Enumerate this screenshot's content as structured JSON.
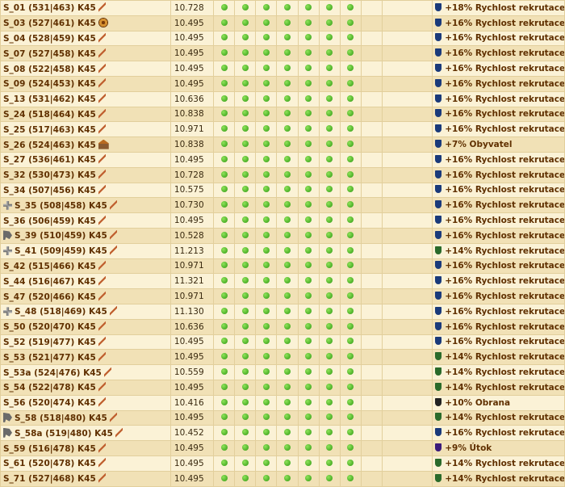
{
  "colors": {
    "green_dot": "#39a51a",
    "shield_blue": "#1a3a7a",
    "shield_green": "#2a6a2a",
    "shield_black": "#222222",
    "shield_purple": "#3a1a7a"
  },
  "rows": [
    {
      "name": "S_01 (531|463) K45",
      "points": "10.728",
      "bonus": "+18% Rychlost rekrutace",
      "pre": "",
      "post": "sword",
      "shield": "blue"
    },
    {
      "name": "S_03 (527|461) K45",
      "points": "10.495",
      "bonus": "+16% Rychlost rekrutace",
      "pre": "",
      "post": "wheel",
      "shield": "blue"
    },
    {
      "name": "S_04 (528|459) K45",
      "points": "10.495",
      "bonus": "+16% Rychlost rekrutace",
      "pre": "",
      "post": "sword",
      "shield": "blue"
    },
    {
      "name": "S_07 (527|458) K45",
      "points": "10.495",
      "bonus": "+16% Rychlost rekrutace",
      "pre": "",
      "post": "sword",
      "shield": "blue"
    },
    {
      "name": "S_08 (522|458) K45",
      "points": "10.495",
      "bonus": "+16% Rychlost rekrutace",
      "pre": "",
      "post": "sword",
      "shield": "blue"
    },
    {
      "name": "S_09 (524|453) K45",
      "points": "10.495",
      "bonus": "+16% Rychlost rekrutace",
      "pre": "",
      "post": "sword",
      "shield": "blue"
    },
    {
      "name": "S_13 (531|462) K45",
      "points": "10.636",
      "bonus": "+16% Rychlost rekrutace",
      "pre": "",
      "post": "sword",
      "shield": "blue"
    },
    {
      "name": "S_24 (518|464) K45",
      "points": "10.838",
      "bonus": "+16% Rychlost rekrutace",
      "pre": "",
      "post": "sword",
      "shield": "blue"
    },
    {
      "name": "S_25 (517|463) K45",
      "points": "10.971",
      "bonus": "+16% Rychlost rekrutace",
      "pre": "",
      "post": "sword",
      "shield": "blue"
    },
    {
      "name": "S_26 (524|463) K45",
      "points": "10.838",
      "bonus": "+7% Obyvatel",
      "pre": "",
      "post": "house",
      "shield": "blue"
    },
    {
      "name": "S_27 (536|461) K45",
      "points": "10.495",
      "bonus": "+16% Rychlost rekrutace",
      "pre": "",
      "post": "sword",
      "shield": "blue"
    },
    {
      "name": "S_32 (530|473) K45",
      "points": "10.728",
      "bonus": "+16% Rychlost rekrutace",
      "pre": "",
      "post": "sword",
      "shield": "blue"
    },
    {
      "name": "S_34 (507|456) K45",
      "points": "10.575",
      "bonus": "+16% Rychlost rekrutace",
      "pre": "",
      "post": "sword",
      "shield": "blue"
    },
    {
      "name": "S_35 (508|458) K45",
      "points": "10.730",
      "bonus": "+16% Rychlost rekrutace",
      "pre": "cross",
      "post": "sword",
      "shield": "blue"
    },
    {
      "name": "S_36 (506|459) K45",
      "points": "10.495",
      "bonus": "+16% Rychlost rekrutace",
      "pre": "",
      "post": "sword",
      "shield": "blue"
    },
    {
      "name": "S_39 (510|459) K45",
      "points": "10.528",
      "bonus": "+16% Rychlost rekrutace",
      "pre": "axe",
      "post": "sword",
      "shield": "blue"
    },
    {
      "name": "S_41 (509|459) K45",
      "points": "11.213",
      "bonus": "+14% Rychlost rekrutace",
      "pre": "cross",
      "post": "sword",
      "shield": "green"
    },
    {
      "name": "S_42 (515|466) K45",
      "points": "10.971",
      "bonus": "+16% Rychlost rekrutace",
      "pre": "",
      "post": "sword",
      "shield": "blue"
    },
    {
      "name": "S_44 (516|467) K45",
      "points": "11.321",
      "bonus": "+16% Rychlost rekrutace",
      "pre": "",
      "post": "sword",
      "shield": "blue"
    },
    {
      "name": "S_47 (520|466) K45",
      "points": "10.971",
      "bonus": "+16% Rychlost rekrutace",
      "pre": "",
      "post": "sword",
      "shield": "blue"
    },
    {
      "name": "S_48 (518|469) K45",
      "points": "11.130",
      "bonus": "+16% Rychlost rekrutace",
      "pre": "cross",
      "post": "sword",
      "shield": "blue"
    },
    {
      "name": "S_50 (520|470) K45",
      "points": "10.636",
      "bonus": "+16% Rychlost rekrutace",
      "pre": "",
      "post": "sword",
      "shield": "blue"
    },
    {
      "name": "S_52 (519|477) K45",
      "points": "10.495",
      "bonus": "+16% Rychlost rekrutace",
      "pre": "",
      "post": "sword",
      "shield": "blue"
    },
    {
      "name": "S_53 (521|477) K45",
      "points": "10.495",
      "bonus": "+14% Rychlost rekrutace",
      "pre": "",
      "post": "sword",
      "shield": "green"
    },
    {
      "name": "S_53a (524|476) K45",
      "points": "10.559",
      "bonus": "+14% Rychlost rekrutace",
      "pre": "",
      "post": "sword",
      "shield": "green"
    },
    {
      "name": "S_54 (522|478) K45",
      "points": "10.495",
      "bonus": "+14% Rychlost rekrutace",
      "pre": "",
      "post": "sword",
      "shield": "green"
    },
    {
      "name": "S_56 (520|474) K45",
      "points": "10.416",
      "bonus": "+10% Obrana",
      "pre": "",
      "post": "sword",
      "shield": "black"
    },
    {
      "name": "S_58 (518|480) K45",
      "points": "10.495",
      "bonus": "+14% Rychlost rekrutace",
      "pre": "axe",
      "post": "sword",
      "shield": "green"
    },
    {
      "name": "S_58a (519|480) K45",
      "points": "10.452",
      "bonus": "+16% Rychlost rekrutace",
      "pre": "axe",
      "post": "sword",
      "shield": "blue"
    },
    {
      "name": "S_59 (516|478) K45",
      "points": "10.495",
      "bonus": "+9% Útok",
      "pre": "",
      "post": "sword",
      "shield": "purple"
    },
    {
      "name": "S_61 (520|478) K45",
      "points": "10.495",
      "bonus": "+14% Rychlost rekrutace",
      "pre": "",
      "post": "sword",
      "shield": "green"
    },
    {
      "name": "S_71 (527|468) K45",
      "points": "10.495",
      "bonus": "+14% Rychlost rekrutace",
      "pre": "",
      "post": "sword",
      "shield": "green"
    }
  ]
}
